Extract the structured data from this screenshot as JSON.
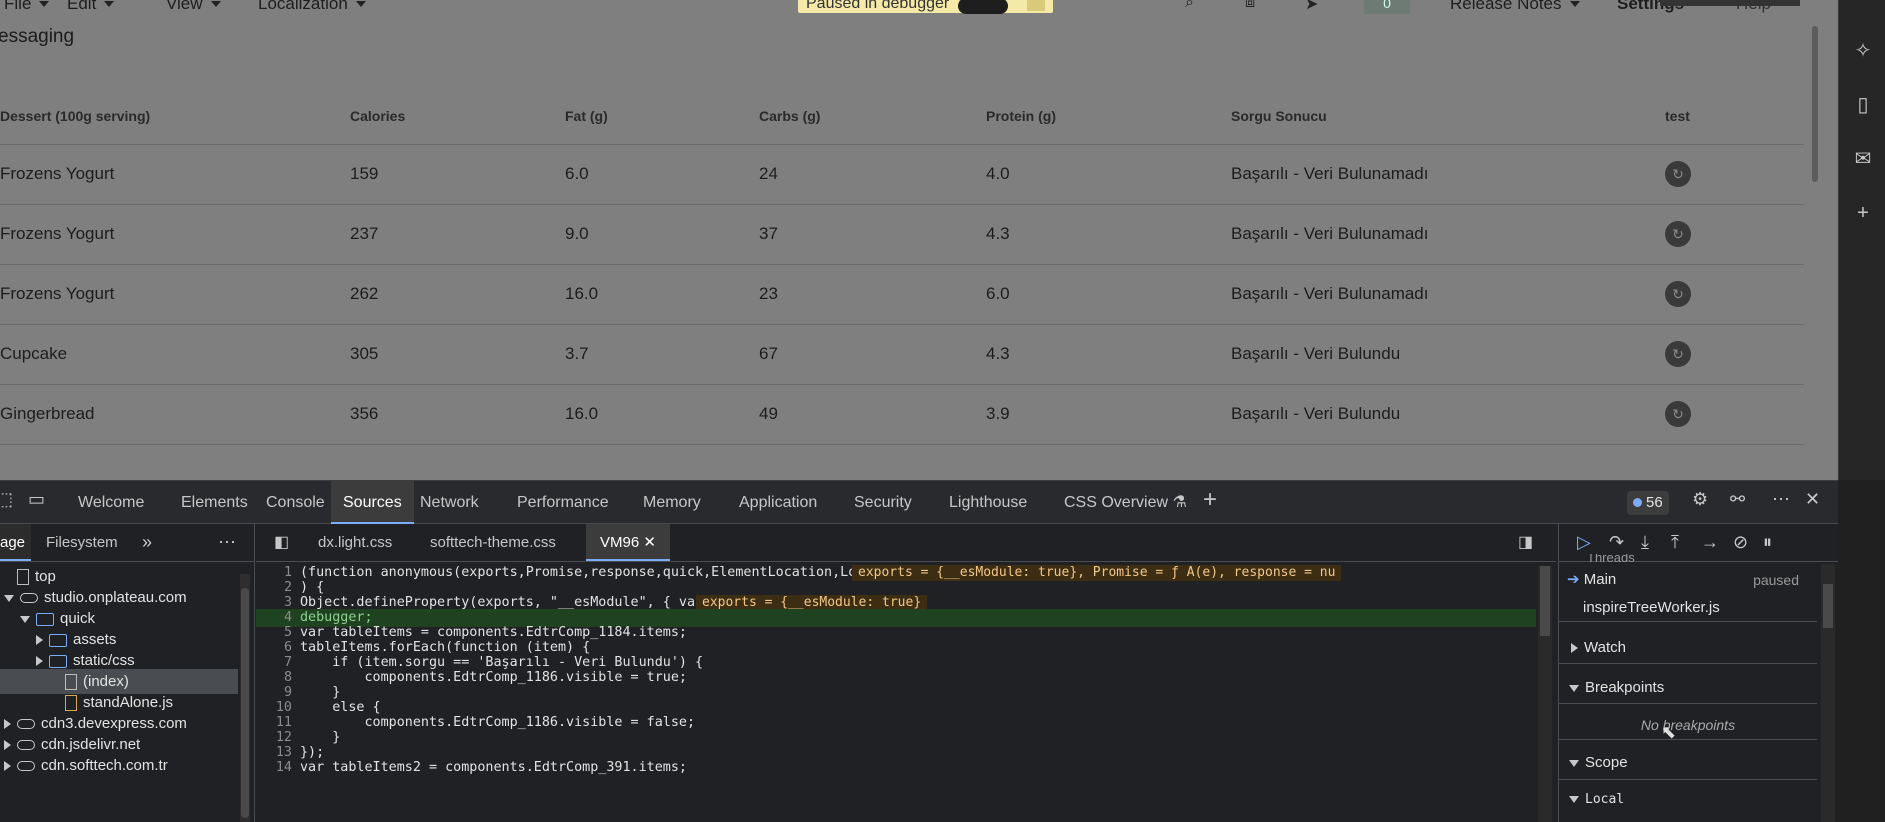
{
  "menubar": {
    "file": "File",
    "edit": "Edit",
    "view": "View",
    "localization": "Localization",
    "paused": "Paused in debugger",
    "badge": "0",
    "release_notes": "Release Notes",
    "settings": "Settings",
    "help": "Help"
  },
  "app": {
    "title": "essaging",
    "columns": [
      "Dessert (100g serving)",
      "Calories",
      "Fat (g)",
      "Carbs (g)",
      "Protein (g)",
      "Sorgu Sonucu",
      "test"
    ],
    "rows": [
      {
        "name": "Frozens Yogurt",
        "calories": "159",
        "fat": "6.0",
        "carbs": "24",
        "protein": "4.0",
        "result": "Başarılı - Veri Bulunamadı"
      },
      {
        "name": "Frozens Yogurt",
        "calories": "237",
        "fat": "9.0",
        "carbs": "37",
        "protein": "4.3",
        "result": "Başarılı - Veri Bulunamadı"
      },
      {
        "name": "Frozens Yogurt",
        "calories": "262",
        "fat": "16.0",
        "carbs": "23",
        "protein": "6.0",
        "result": "Başarılı - Veri Bulunamadı"
      },
      {
        "name": "Cupcake",
        "calories": "305",
        "fat": "3.7",
        "carbs": "67",
        "protein": "4.3",
        "result": "Başarılı - Veri Bulundu"
      },
      {
        "name": "Gingerbread",
        "calories": "356",
        "fat": "16.0",
        "carbs": "49",
        "protein": "3.9",
        "result": "Başarılı - Veri Bulundu"
      }
    ]
  },
  "devtools": {
    "tabs": [
      "Welcome",
      "Elements",
      "Console",
      "Sources",
      "Network",
      "Performance",
      "Memory",
      "Application",
      "Security",
      "Lighthouse",
      "CSS Overview"
    ],
    "issues_count": "56",
    "navigator": {
      "tabs": [
        "age",
        "Filesystem"
      ],
      "tree": [
        {
          "label": "top",
          "level": 0,
          "icon": "square",
          "expand": "none"
        },
        {
          "label": "studio.onplateau.com",
          "level": 0,
          "icon": "cloud",
          "expand": "down"
        },
        {
          "label": "quick",
          "level": 1,
          "icon": "folder",
          "expand": "down"
        },
        {
          "label": "assets",
          "level": 2,
          "icon": "folder",
          "expand": "right"
        },
        {
          "label": "static/css",
          "level": 2,
          "icon": "folder",
          "expand": "right"
        },
        {
          "label": "(index)",
          "level": 3,
          "icon": "file",
          "expand": "none"
        },
        {
          "label": "standAlone.js",
          "level": 3,
          "icon": "file-js",
          "expand": "none"
        },
        {
          "label": "cdn3.devexpress.com",
          "level": 0,
          "icon": "cloud",
          "expand": "right"
        },
        {
          "label": "cdn.jsdelivr.net",
          "level": 0,
          "icon": "cloud",
          "expand": "right"
        },
        {
          "label": "cdn.softtech.com.tr",
          "level": 0,
          "icon": "cloud",
          "expand": "right"
        }
      ]
    },
    "editor": {
      "tabs": [
        "dx.light.css",
        "softtech-theme.css",
        "VM96"
      ],
      "lines": [
        "(function anonymous(exports,Promise,response,quick,ElementLocation,LogType,components",
        ") {",
        "Object.defineProperty(exports, \"__esModule\", { value: true });",
        "debugger;",
        "var tableItems = components.EdtrComp_1184.items;",
        "tableItems.forEach(function (item) {",
        "    if (item.sorgu == 'Başarılı - Veri Bulundu') {",
        "        components.EdtrComp_1186.visible = true;",
        "    }",
        "    else {",
        "        components.EdtrComp_1186.visible = false;",
        "    }",
        "});",
        "var tableItems2 = components.EdtrComp_391.items;"
      ],
      "inline_value_1": "exports = {__esModule: true}, Promise = ƒ A(e), response = nu",
      "inline_value_3": "exports = {__esModule: true}"
    },
    "debugger": {
      "threads_label": "Threads",
      "main": "Main",
      "paused": "paused",
      "worker": "inspireTreeWorker.js",
      "watch": "Watch",
      "breakpoints": "Breakpoints",
      "no_breakpoints": "No breakpoints",
      "scope": "Scope",
      "local": "Local"
    }
  }
}
